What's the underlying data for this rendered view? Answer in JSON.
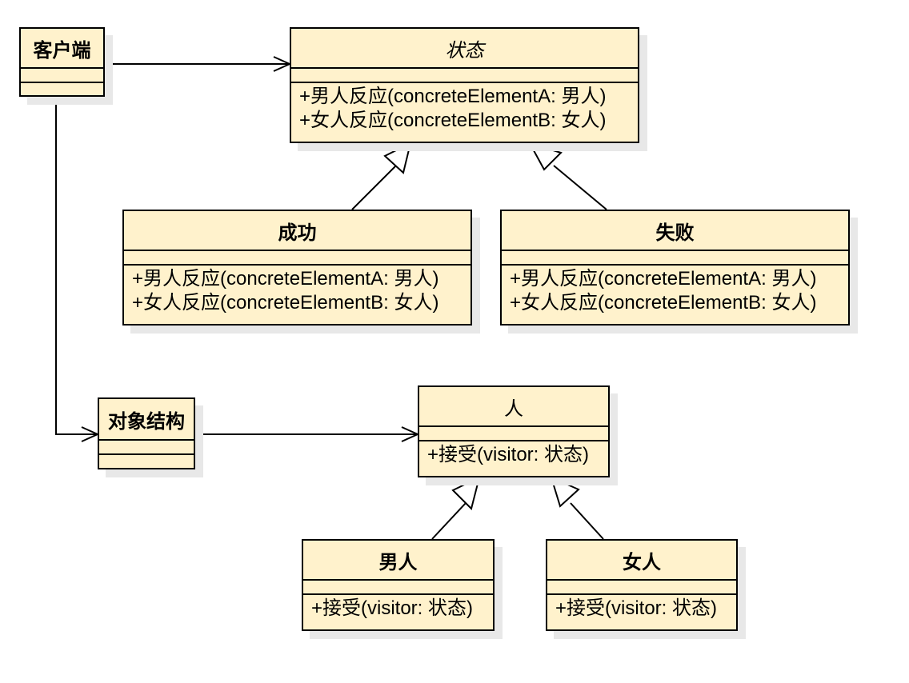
{
  "colors": {
    "box_fill": "#fff2cc",
    "stroke": "#000000",
    "shadow": "#e8e8e8",
    "background": "#ffffff"
  },
  "classes": {
    "client": {
      "name": "客户端"
    },
    "state": {
      "name": "状态",
      "methods": [
        "+男人反应(concreteElementA: 男人)",
        "+女人反应(concreteElementB: 女人)"
      ]
    },
    "success": {
      "name": "成功",
      "methods": [
        "+男人反应(concreteElementA: 男人)",
        "+女人反应(concreteElementB: 女人)"
      ]
    },
    "failure": {
      "name": "失败",
      "methods": [
        "+男人反应(concreteElementA: 男人)",
        "+女人反应(concreteElementB: 女人)"
      ]
    },
    "object_structure": {
      "name": "对象结构"
    },
    "person": {
      "name": "人",
      "methods": [
        "+接受(visitor: 状态)"
      ]
    },
    "man": {
      "name": "男人",
      "methods": [
        "+接受(visitor: 状态)"
      ]
    },
    "woman": {
      "name": "女人",
      "methods": [
        "+接受(visitor: 状态)"
      ]
    }
  },
  "relations": [
    {
      "from": "client",
      "to": "state",
      "kind": "association"
    },
    {
      "from": "client",
      "to": "object_structure",
      "kind": "association"
    },
    {
      "from": "object_structure",
      "to": "person",
      "kind": "association"
    },
    {
      "from": "success",
      "to": "state",
      "kind": "generalization"
    },
    {
      "from": "failure",
      "to": "state",
      "kind": "generalization"
    },
    {
      "from": "man",
      "to": "person",
      "kind": "generalization"
    },
    {
      "from": "woman",
      "to": "person",
      "kind": "generalization"
    }
  ]
}
